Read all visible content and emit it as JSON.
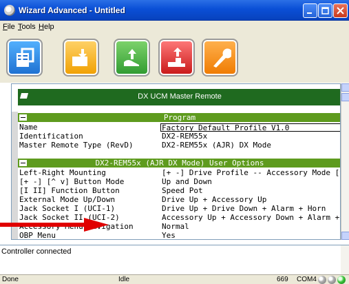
{
  "window": {
    "title": "Wizard Advanced - Untitled"
  },
  "menu": {
    "items": [
      "File",
      "Tools",
      "Help"
    ]
  },
  "toolbar": {
    "buttons": [
      {
        "icon": "open-profile-icon"
      },
      {
        "icon": "read-controller-icon"
      },
      {
        "icon": "write-controller-icon"
      },
      {
        "icon": "program-controller-icon"
      },
      {
        "icon": "tools-wrench-icon"
      }
    ]
  },
  "grid": {
    "header": "DX UCM Master Remote",
    "sections": [
      {
        "title": "Program",
        "rows": [
          {
            "name": "Name",
            "value": "Factory Default Profile V1.0"
          },
          {
            "name": "Identification",
            "value": "DX2-REM55x"
          },
          {
            "name": "Master Remote Type (RevD)",
            "value": "DX2-REM55x (AJR) DX Mode"
          }
        ]
      },
      {
        "title": "DX2-REM55x (AJR DX Mode) User Options",
        "rows": [
          {
            "name": "Left-Right Mounting",
            "value": "[+ -] Drive Profile -- Accessory Mode [^ v]"
          },
          {
            "name": "[+ -] [^ v] Button Mode",
            "value": "Up and Down"
          },
          {
            "name": "[I II] Function Button",
            "value": "Speed Pot"
          },
          {
            "name": "External Mode Up/Down",
            "value": "Drive Up + Accessory Up"
          },
          {
            "name": "Jack Socket I (UCI-1)",
            "value": "Drive Up + Drive Down + Alarm + Horn"
          },
          {
            "name": "Jack Socket II (UCI-2)",
            "value": "Accessory Up + Accessory Down + Alarm + Hor"
          },
          {
            "name": "Accessory Menu Navigation",
            "value": "Normal"
          },
          {
            "name": "OBP Menu",
            "value": "Yes"
          }
        ]
      }
    ]
  },
  "log": {
    "text": "Controller connected"
  },
  "status": {
    "left": "Done",
    "state": "Idle",
    "count": "669",
    "port": "COM4"
  },
  "colors": {
    "header_bar": "#1f6a1f",
    "section_bar": "#5e9b1e",
    "annotation_arrow": "#e00000"
  }
}
